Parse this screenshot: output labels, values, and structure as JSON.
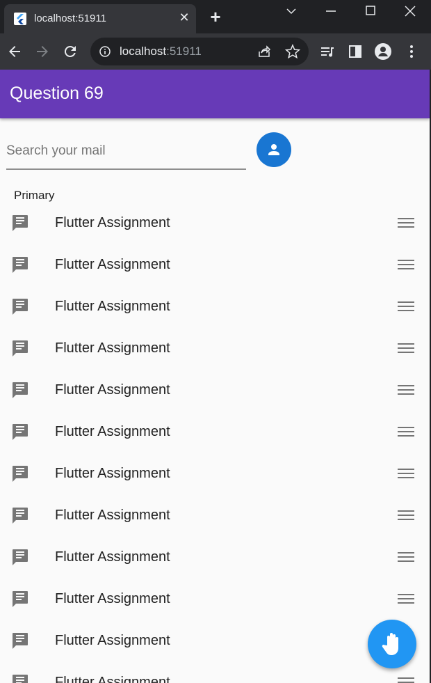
{
  "browser": {
    "tab_title": "localhost:51911",
    "url_host": "localhost",
    "url_port": ":51911",
    "icons": [
      "flutter-favicon",
      "close-icon",
      "plus-icon",
      "chevron-down-icon",
      "minimize-icon",
      "maximize-icon",
      "window-close-icon",
      "back-arrow-icon",
      "forward-arrow-icon",
      "reload-icon",
      "info-icon",
      "share-icon",
      "star-icon",
      "reading-list-icon",
      "side-panel-icon",
      "profile-icon",
      "kebab-menu-icon"
    ]
  },
  "app": {
    "title": "Question 69",
    "accent": "#673ab7",
    "search": {
      "placeholder": "Search your mail",
      "value": ""
    },
    "section_label": "Primary",
    "items": [
      {
        "label": "Flutter Assignment"
      },
      {
        "label": "Flutter Assignment"
      },
      {
        "label": "Flutter Assignment"
      },
      {
        "label": "Flutter Assignment"
      },
      {
        "label": "Flutter Assignment"
      },
      {
        "label": "Flutter Assignment"
      },
      {
        "label": "Flutter Assignment"
      },
      {
        "label": "Flutter Assignment"
      },
      {
        "label": "Flutter Assignment"
      },
      {
        "label": "Flutter Assignment"
      },
      {
        "label": "Flutter Assignment"
      },
      {
        "label": "Flutter Assignment"
      }
    ],
    "avatar_color": "#1976d2",
    "fab_color": "#2196f3",
    "fab_icon": "hand-icon"
  }
}
